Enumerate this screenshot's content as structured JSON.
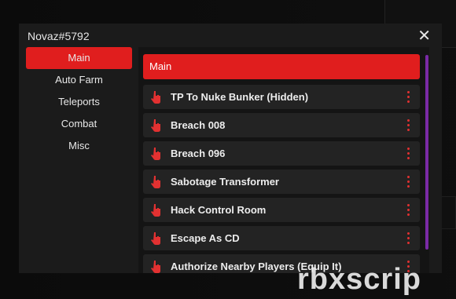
{
  "window": {
    "title": "Novaz#5792",
    "close_symbol": "✕"
  },
  "sidebar": {
    "items": [
      {
        "label": "Main",
        "active": true
      },
      {
        "label": "Auto Farm",
        "active": false
      },
      {
        "label": "Teleports",
        "active": false
      },
      {
        "label": "Combat",
        "active": false
      },
      {
        "label": "Misc",
        "active": false
      }
    ]
  },
  "main": {
    "section_title": "Main",
    "buttons": [
      {
        "label": "TP To Nuke Bunker (Hidden)",
        "icon": "hand-pointer-icon"
      },
      {
        "label": "Breach 008",
        "icon": "hand-pointer-icon"
      },
      {
        "label": "Breach 096",
        "icon": "hand-pointer-icon"
      },
      {
        "label": "Sabotage Transformer",
        "icon": "hand-pointer-icon"
      },
      {
        "label": "Hack Control Room",
        "icon": "hand-pointer-icon"
      },
      {
        "label": "Escape As CD",
        "icon": "hand-pointer-icon"
      },
      {
        "label": "Authorize Nearby Players (Equip It)",
        "icon": "hand-pointer-icon"
      }
    ]
  },
  "colors": {
    "accent": "#e01e1e",
    "scrollbar": "#7a2aa6",
    "panel": "#1b1b1b",
    "row": "#232323"
  },
  "watermark": "rbxscrip"
}
